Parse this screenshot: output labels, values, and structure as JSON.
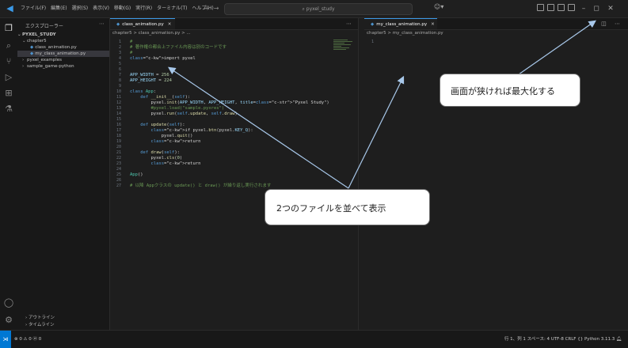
{
  "menu": [
    "ファイル(F)",
    "編集(E)",
    "選択(S)",
    "表示(V)",
    "移動(G)",
    "実行(R)",
    "ターミナル(T)",
    "ヘルプ(H)"
  ],
  "search": {
    "text": "pyxel_study"
  },
  "sidebar": {
    "title": "エクスプローラー",
    "root": "PYXEL_STUDY",
    "items": [
      {
        "label": "chapter5"
      },
      {
        "label": "class_animation.py"
      },
      {
        "label": "my_class_animation.py"
      },
      {
        "label": "pyxel_examples"
      },
      {
        "label": "sample_game-python"
      }
    ],
    "outline": "アウトライン",
    "timeline": "タイムライン"
  },
  "left_editor": {
    "tabs": [
      {
        "label": "class_animation.py"
      },
      {
        "label": "my_class_animation.py"
      }
    ],
    "breadcrumb": "chapter5 > class_animation.py > ...",
    "lines": [
      "#",
      "# 著作権の都合上ファイル内容は別のコードです",
      "#",
      "import pyxel",
      "",
      "",
      "APP_WIDTH = 256",
      "APP_HEIGHT = 224",
      "",
      "class App:",
      "    def __init__(self):",
      "        pyxel.init(APP_WIDTH, APP_HEIGHT, title=\"Pyxel Study\")",
      "        #pyxel.load(\"sample.pyxres\")",
      "        pyxel.run(self.update, self.draw)",
      "",
      "    def update(self):",
      "        if pyxel.btn(pyxel.KEY_Q):",
      "            pyxel.quit()",
      "        return",
      "",
      "    def draw(self):",
      "        pyxel.cls(0)",
      "        return",
      "",
      "App()",
      "",
      "# 以降 Appクラスの update() と draw() が繰り返し実行されます"
    ]
  },
  "right_editor": {
    "tab": "my_class_animation.py",
    "breadcrumb": "chapter5 > my_class_animation.py",
    "line_numbers": [
      "1"
    ]
  },
  "statusbar": {
    "left": "⊗ 0 ⚠ 0   ⓦ 0",
    "right": "行 1、列 1   スペース: 4   UTF-8   CRLF   {} Python   3.11.3"
  },
  "annotations": {
    "maximize": "画面が狭ければ最大化する",
    "side_by_side": "2つのファイルを並べて表示"
  }
}
